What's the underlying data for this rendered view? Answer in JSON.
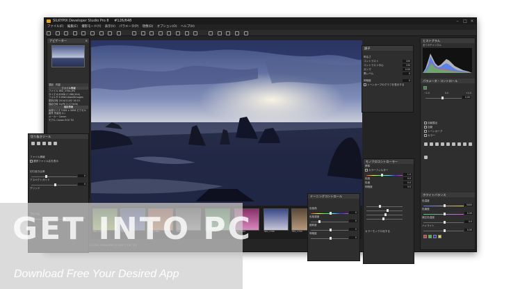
{
  "app": {
    "title": "SILKYPIX Developer Studio Pro 8",
    "counter": "#126/648",
    "window_controls": [
      "–",
      "□",
      "×"
    ]
  },
  "menubar": [
    "ファイル(F)",
    "編集(E)",
    "撮影モード(Y)",
    "表示(V)",
    "パラメータ(P)",
    "現像(D)",
    "オプション(O)",
    "ヘルプ(H)"
  ],
  "navigator": {
    "title": "ナビゲーター",
    "close": "×"
  },
  "exif": {
    "headers": [
      "項目",
      "内容"
    ],
    "group1": "ファイル情報",
    "rows": [
      [
        "ファイル",
        "IMG_3784.JPG"
      ],
      [
        "サイズ",
        "6.63MB (7,066,504)"
      ],
      [
        "フォルダ",
        "E:¥Windows¥Images"
      ],
      [
        "更新日時",
        "2014/11/02 16:15"
      ],
      [
        "撮影日時",
        "SlyPX 3 (C7406)"
      ]
    ],
    "group2": "撮影情報",
    "rows2": [
      [
        "画像サイズ",
        "5184 x 3456 ピクセル"
      ],
      [
        "画質",
        "質量化 (L)"
      ],
      [
        "メーカー",
        "Canon"
      ],
      [
        "モデル",
        "Canon EOS 7D"
      ]
    ]
  },
  "tool_panel": {
    "title": "切り抜きツール",
    "labels": [
      "ファイル情報",
      "選択ファイル名を表示",
      "切り抜き比率",
      "アスペクトガイド",
      "グリッド",
      "フレーム"
    ],
    "values": [
      "0",
      "0",
      "100%"
    ]
  },
  "histogram": {
    "title": "ヒストグラム",
    "channel": "全てのチャンネル"
  },
  "params": {
    "title": "パラメータ・コントロール",
    "tone_values": [
      "−2.0",
      "0.0",
      "+2.0"
    ],
    "ev": "0.00",
    "items": [
      "自動露出",
      "自動",
      "トーンカーブ",
      "カラー"
    ]
  },
  "tone": {
    "title": "調子",
    "rows": [
      {
        "label": "明るさ",
        "value": "0"
      },
      {
        "label": "コントラスト",
        "value": "100"
      },
      {
        "label": "コントラスト中心",
        "value": "130"
      },
      {
        "label": "ガンマ",
        "value": "0.00"
      },
      {
        "label": "黒レベル",
        "value": "0"
      },
      {
        "label": "明暗度",
        "value": "0"
      }
    ],
    "checkbox": "トーンカーブのグラフを表示する"
  },
  "monochrome": {
    "title": "モノクロコントローラー",
    "subtitle": "標準",
    "rows": [
      {
        "label": "カラーフィルター",
        "value": "1.0"
      },
      {
        "label": "色相",
        "value": "0.0"
      },
      {
        "label": "彩度",
        "value": "0.0"
      },
      {
        "label": "明暗度",
        "value": "0.0"
      }
    ],
    "footer": "カラーモノクロ化する"
  },
  "toning": {
    "title": "ドーニングコントロール",
    "rows": [
      {
        "label": "色相角",
        "value": "0"
      },
      {
        "label": "色相濃度",
        "value": "0"
      },
      {
        "label": "飽和度",
        "value": "0"
      },
      {
        "label": "明暗度",
        "value": "0"
      }
    ]
  },
  "white_balance": {
    "title": "ホワイトバランス",
    "rows": [
      {
        "label": "色温度",
        "value": "5000"
      },
      {
        "label": "色偏差",
        "value": "0.00"
      },
      {
        "label": "補正色温度",
        "value": "0.0"
      },
      {
        "label": "ハイライト",
        "value": "0.00"
      }
    ]
  },
  "filmstrip": {
    "captions": [
      "IMG_3752",
      "IMG_3761",
      "IMG_3764",
      "IMG_3770",
      "IMG_3777",
      "IMG_3782",
      "IMG_3786",
      "IMG_3790",
      "IMG_3796"
    ],
    "status": "1.11 / 1:1 (12%) 5184x3456 11:28:57 / 1:8 / 3:2"
  },
  "watermark": {
    "logo": "GET INTO PC",
    "tagline": "Download Free Your Desired App"
  },
  "colors": {
    "accent": "#e6a21a",
    "window_bg": "#242424",
    "panel_bg": "#2e2e2e"
  }
}
